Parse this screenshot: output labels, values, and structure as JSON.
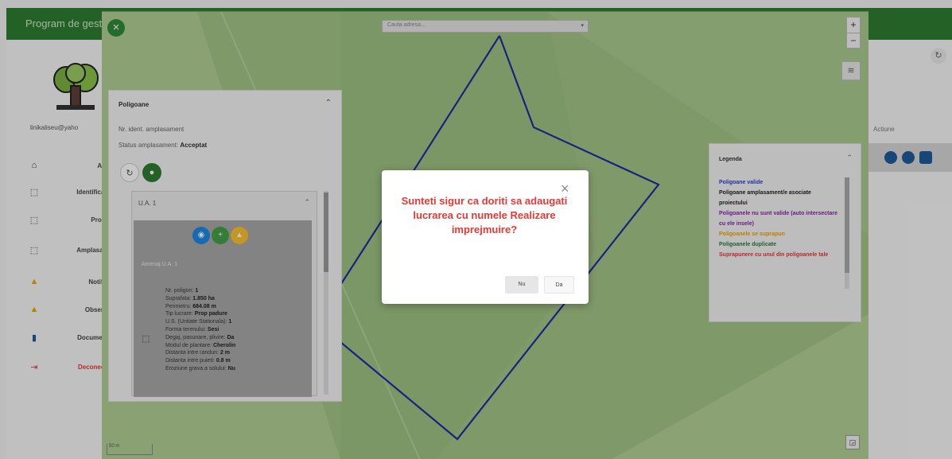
{
  "app": {
    "title": "Program de gest"
  },
  "sidebar": {
    "user_email": "linikaliseu@yaho",
    "items": [
      {
        "icon": "home-icon",
        "label": "Acasa"
      },
      {
        "icon": "polygon-icon",
        "label": "Identificare p"
      },
      {
        "icon": "polygon-icon",
        "label": "Proiecte"
      },
      {
        "icon": "polygon-icon",
        "label": "Amplasamen"
      },
      {
        "icon": "warning-icon",
        "label": "Notificari"
      },
      {
        "icon": "warning-icon",
        "label": "Observatii"
      },
      {
        "icon": "document-icon",
        "label": "Documente r"
      },
      {
        "icon": "logout-icon",
        "label": "Deconectare"
      }
    ]
  },
  "background": {
    "column_header": "Actiune",
    "refresh_icon": "refresh-icon"
  },
  "map": {
    "search_placeholder": "Cauta adresa...",
    "zoom_in": "+",
    "zoom_out": "−",
    "scale_label": "50 m"
  },
  "polygons_panel": {
    "title": "Poligoane",
    "site_number_label": "Nr. ident. amplasament",
    "status_label": "Status amplasament:",
    "status_value": "Acceptat",
    "ua": {
      "title": "U.A. 1",
      "subtitle": "Amenaj U.A. 1",
      "details": [
        {
          "label": "Nr. poligon:",
          "value": "1"
        },
        {
          "label": "Suprafata:",
          "value": "1.850 ha"
        },
        {
          "label": "Perimetru:",
          "value": "684.08 m"
        },
        {
          "label": "Tip lucrare:",
          "value": "Prop padure"
        },
        {
          "label": "U.S. (Unitate Stationala):",
          "value": "1"
        },
        {
          "label": "Forma terenului:",
          "value": "Sesi"
        },
        {
          "label": "Degaj, pasunare, plivire:",
          "value": "Da"
        },
        {
          "label": "Modul de plantare:",
          "value": "Cherolin"
        },
        {
          "label": "Distanta intre randuri:",
          "value": "2 m"
        },
        {
          "label": "Distanta intre puieti:",
          "value": "0.8 m"
        },
        {
          "label": "Eroziune grava a solului:",
          "value": "Nu"
        }
      ]
    }
  },
  "legend": {
    "title": "Legenda",
    "items": [
      {
        "label": "Poligoane valide",
        "color": "#2d3ed8"
      },
      {
        "label": "Poligoane amplasament/e asociate proiectului",
        "color": "#222222"
      },
      {
        "label": "Poligoanele nu sunt valide (auto intersectare cu ele insele)",
        "color": "#8e24aa"
      },
      {
        "label": "Poligoanele se suprapun",
        "color": "#f0a500"
      },
      {
        "label": "Poligoanele duplicate",
        "color": "#2e7d32"
      },
      {
        "label": "Suprapunere cu unul din poligoanele tale",
        "color": "#e53935"
      }
    ]
  },
  "dialog": {
    "message": "Sunteti sigur ca doriti sa adaugati lucrarea cu numele Realizare imprejmuire?",
    "no_label": "Nu",
    "yes_label": "Da"
  }
}
